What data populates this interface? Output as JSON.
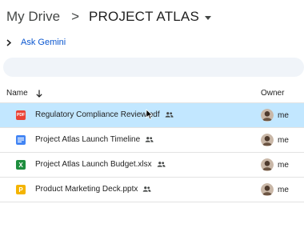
{
  "breadcrumb": {
    "root": "My Drive",
    "separator": ">",
    "current": "PROJECT ATLAS"
  },
  "gemini": {
    "label": "Ask Gemini"
  },
  "columns": {
    "name": "Name",
    "owner": "Owner"
  },
  "files": [
    {
      "name": "Regulatory Compliance Review.pdf",
      "type": "pdf",
      "icon_text": "PDF",
      "icon": "pdf-file-icon",
      "color": "#ea4335",
      "owner": "me",
      "selected": true
    },
    {
      "name": "Project Atlas Launch Timeline",
      "type": "doc",
      "icon_text": "",
      "icon": "google-docs-icon",
      "color": "#4285f4",
      "owner": "me",
      "selected": false
    },
    {
      "name": "Project Atlas Launch Budget.xlsx",
      "type": "xlsx",
      "icon_text": "X",
      "icon": "excel-file-icon",
      "color": "#1e8e3e",
      "owner": "me",
      "selected": false
    },
    {
      "name": "Product Marketing Deck.pptx",
      "type": "pptx",
      "icon_text": "P",
      "icon": "powerpoint-file-icon",
      "color": "#f4b400",
      "owner": "me",
      "selected": false
    }
  ],
  "colors": {
    "selected_row": "#c2e7ff",
    "link": "#0b57d0",
    "search_bg": "#f0f4f9"
  }
}
